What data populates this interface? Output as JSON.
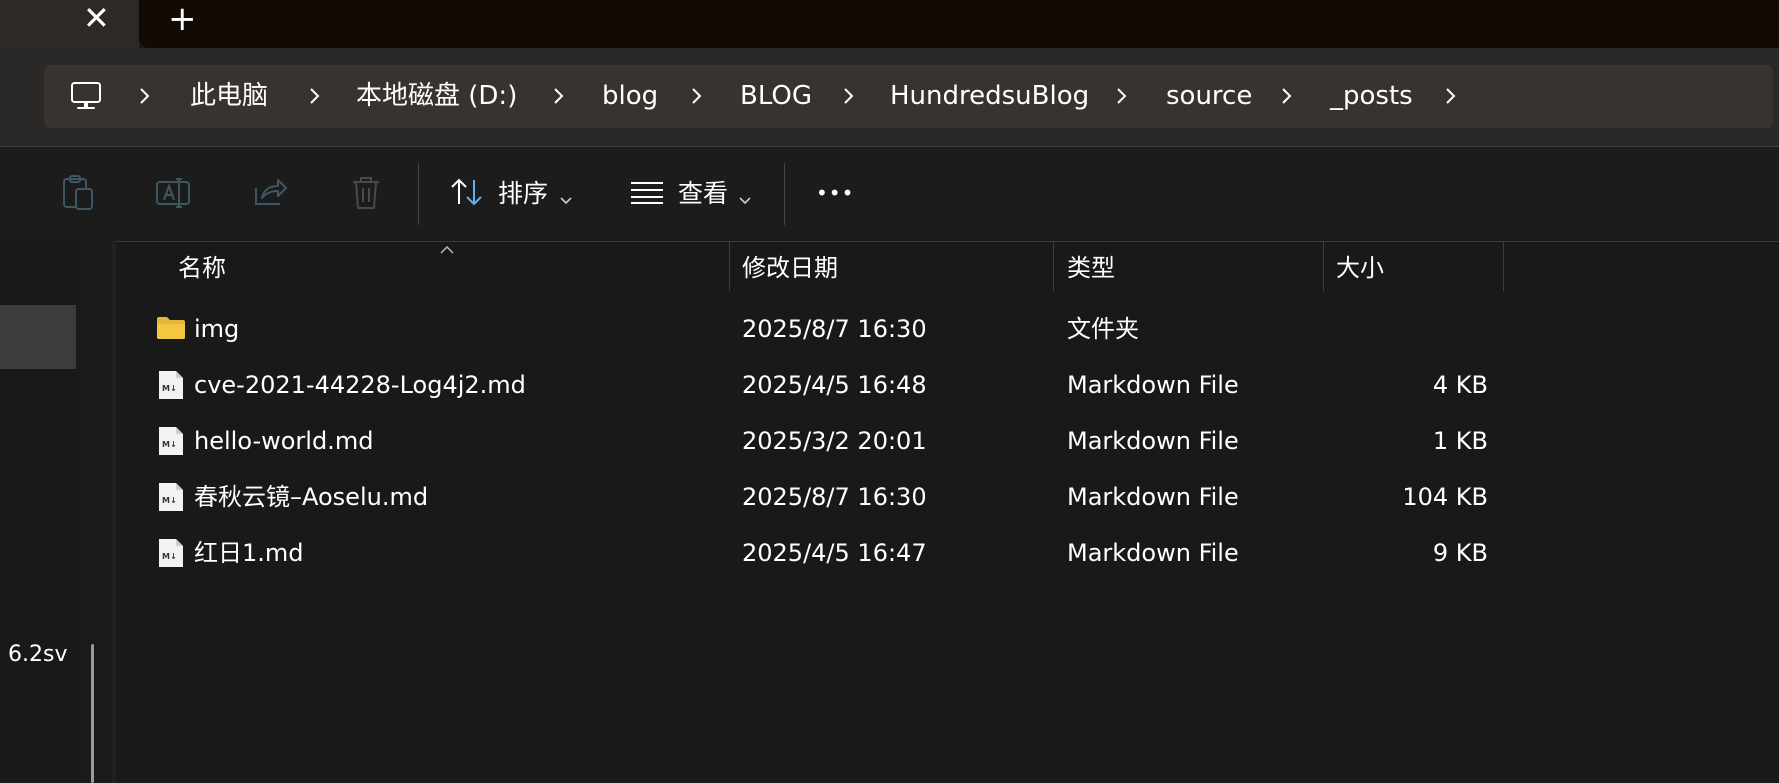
{
  "tabs": {
    "close_glyph": "✕",
    "new_tab_glyph": "+"
  },
  "breadcrumb": {
    "items": [
      "此电脑",
      "本地磁盘 (D:)",
      "blog",
      "BLOG",
      "HundredsuBlog",
      "source",
      "_posts"
    ]
  },
  "toolbar": {
    "icons": [
      "paste-icon",
      "rename-icon",
      "share-icon",
      "delete-icon"
    ],
    "sort_label": "排序",
    "view_label": "查看",
    "more_label": "•••"
  },
  "nav": {
    "visible_text": "6.2sv"
  },
  "columns": {
    "name": "名称",
    "modified": "修改日期",
    "type": "类型",
    "size": "大小"
  },
  "files": [
    {
      "icon": "folder-icon",
      "name": "img",
      "modified": "2025/8/7 16:30",
      "type": "文件夹",
      "size": ""
    },
    {
      "icon": "markdown-file-icon",
      "name": "cve-2021-44228-Log4j2.md",
      "modified": "2025/4/5 16:48",
      "type": "Markdown File",
      "size": "4 KB"
    },
    {
      "icon": "markdown-file-icon",
      "name": "hello-world.md",
      "modified": "2025/3/2 20:01",
      "type": "Markdown File",
      "size": "1 KB"
    },
    {
      "icon": "markdown-file-icon",
      "name": "春秋云镜–Aoselu.md",
      "modified": "2025/8/7 16:30",
      "type": "Markdown File",
      "size": "104 KB"
    },
    {
      "icon": "markdown-file-icon",
      "name": "红日1.md",
      "modified": "2025/4/5 16:47",
      "type": "Markdown File",
      "size": "9 KB"
    }
  ],
  "colors": {
    "background": "#191919",
    "tab_strip": "#130905",
    "address_region": "#2b2927",
    "address_bar": "#363330",
    "folder": "#f4c743",
    "accent": "#5fb2f2"
  }
}
